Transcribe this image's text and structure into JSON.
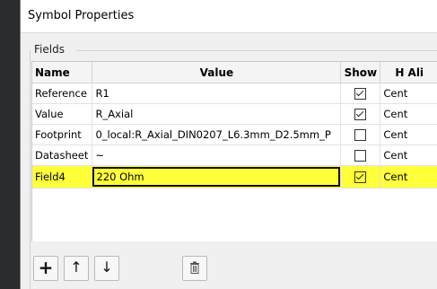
{
  "window": {
    "title": "Symbol Properties"
  },
  "fields_group": {
    "label": "Fields"
  },
  "table": {
    "columns": [
      "Name",
      "Value",
      "Show",
      "H Ali"
    ],
    "rows": [
      {
        "name": "Reference",
        "value": "R1",
        "show": true,
        "h_align": "Cent",
        "highlighted": false
      },
      {
        "name": "Value",
        "value": "R_Axial",
        "show": true,
        "h_align": "Cent",
        "highlighted": false
      },
      {
        "name": "Footprint",
        "value": "0_local:R_Axial_DIN0207_L6.3mm_D2.5mm_P",
        "show": false,
        "h_align": "Cent",
        "highlighted": false
      },
      {
        "name": "Datasheet",
        "value": "~",
        "show": false,
        "h_align": "Cent",
        "highlighted": false
      },
      {
        "name": "Field4",
        "value": "220 Ohm",
        "show": true,
        "h_align": "Cent",
        "highlighted": true
      }
    ]
  },
  "toolbar": {
    "add_glyph": "+",
    "up_glyph": "↑",
    "down_glyph": "↓",
    "buttons": [
      "add-icon",
      "arrow-up-icon",
      "arrow-down-icon",
      "trash-icon"
    ]
  },
  "colors": {
    "highlight": "#ffff3a",
    "outer_background": "#2a2d30"
  }
}
